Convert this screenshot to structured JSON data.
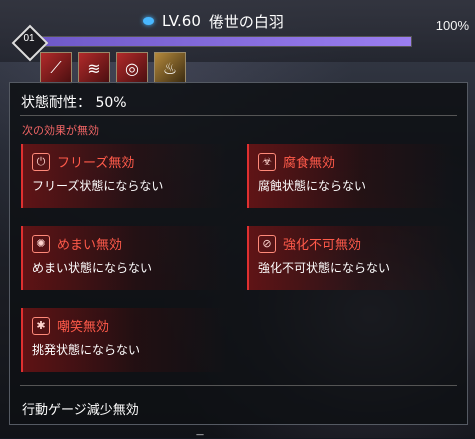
{
  "header": {
    "level_text": "LV.60",
    "boss_name": "倦世の白羽",
    "hp_percent_text": "100%",
    "hp_fill_fraction": 1.0,
    "gauge_number": "01",
    "buff_icons": [
      "red-slash-icon",
      "red-claws-icon",
      "red-spiral-icon",
      "gold-flame-icon"
    ]
  },
  "panel": {
    "title": "状態耐性： 50%",
    "section_label": "次の効果が無効",
    "effects": [
      {
        "name": "フリーズ無効",
        "desc": "フリーズ状態にならない",
        "icon": "power-icon",
        "glyph": "⏻"
      },
      {
        "name": "腐食無効",
        "desc": "腐蝕状態にならない",
        "icon": "biohazard-icon",
        "glyph": "☣"
      },
      {
        "name": "めまい無効",
        "desc": "めまい状態にならない",
        "icon": "dizzy-icon",
        "glyph": "✺"
      },
      {
        "name": "強化不可無効",
        "desc": "強化不可状態にならない",
        "icon": "no-buff-icon",
        "glyph": "⊘"
      },
      {
        "name": "嘲笑無効",
        "desc": "挑発状態にならない",
        "icon": "taunt-icon",
        "glyph": "✱"
      }
    ],
    "footer": "行動ゲージ減少無効"
  },
  "colors": {
    "accent_red": "#e03030",
    "effect_name": "#ff5a4a",
    "hp_bar": "#8a6fe0"
  }
}
